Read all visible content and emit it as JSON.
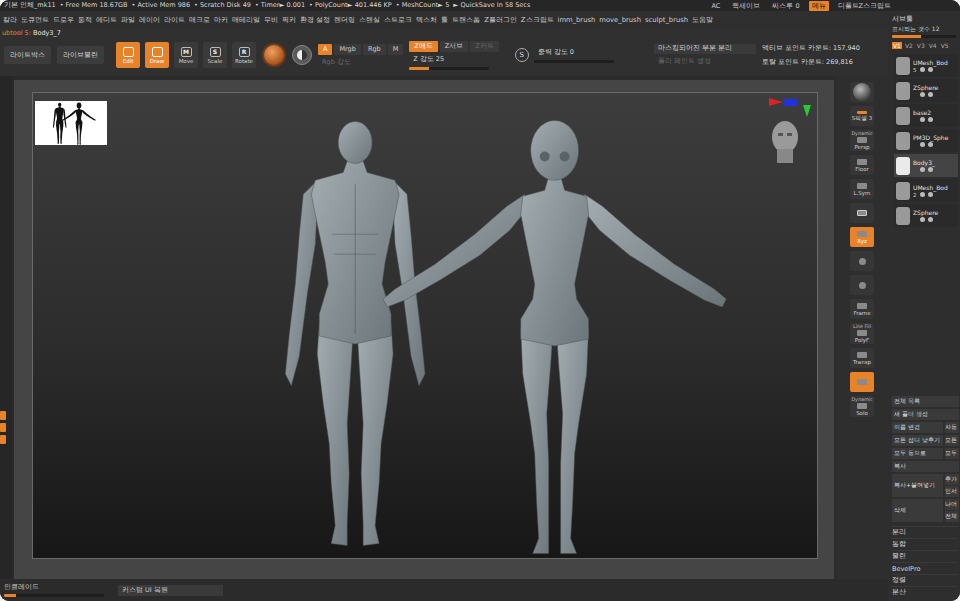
{
  "title_bar": {
    "items": [
      "기본 인체_mk11",
      "• Free Mem 18.67GB",
      "• Active Mem 986",
      "• Scratch Disk 49",
      "• Timer► 0.001",
      "• PolyCount► 401.446 KP",
      "• MeshCount► 5",
      "► QuickSave In 58 Secs"
    ],
    "right": [
      {
        "label": "AC",
        "selected": false
      },
      {
        "label": "퀵세이브",
        "selected": false
      },
      {
        "label": "씨스루 0",
        "selected": false
      },
      {
        "label": "메뉴",
        "selected": true
      },
      {
        "label": "디폴트Z스크립트",
        "selected": false
      }
    ]
  },
  "menu": [
    "칼라",
    "도큐먼트",
    "드로우",
    "동적",
    "에디트",
    "파일",
    "레이어",
    "라이트",
    "매크로",
    "마커",
    "매테리얼",
    "무비",
    "픽커",
    "환경 설정",
    "렌더링",
    "스텐실",
    "스트로크",
    "텍스처",
    "툴",
    "트랜스폼",
    "Z플러그인",
    "Z스크립트",
    "imm_brush",
    "move_brush",
    "sculpt_brush",
    "도움말"
  ],
  "tool_label": {
    "prefix": "ubtool 5:",
    "name": "Body3_7"
  },
  "toolbar": {
    "buttons": [
      "라이트박스",
      "라이브불린"
    ],
    "transform": [
      {
        "label": "Edit",
        "glyph": "",
        "selected": true
      },
      {
        "label": "Draw",
        "glyph": "",
        "selected": true
      },
      {
        "label": "Move",
        "glyph": "M",
        "selected": false
      },
      {
        "label": "Scale",
        "glyph": "S",
        "selected": false
      },
      {
        "label": "Rotate",
        "glyph": "R",
        "selected": false
      }
    ],
    "color_modes": [
      {
        "label": "A",
        "selected": true
      },
      {
        "label": "Mrgb",
        "selected": false
      },
      {
        "label": "Rgb",
        "selected": false
      },
      {
        "label": "M",
        "selected": false
      }
    ],
    "rgb_intensity": {
      "label": "Rgb 강도",
      "disabled": true
    },
    "z_modes": [
      {
        "label": "Z애드",
        "selected": true,
        "disabled": false
      },
      {
        "label": "Z서브",
        "selected": false,
        "disabled": false
      },
      {
        "label": "Z커트",
        "selected": false,
        "disabled": true
      }
    ],
    "z_intensity": {
      "label": "Z 강도 25",
      "level": 0.25
    },
    "gravity": {
      "glyph": "S",
      "label": "중력 강도 0",
      "level": 0
    },
    "actions": [
      {
        "label": "마스킹되어진 부분 분리",
        "disabled": false
      },
      {
        "label": "폴리 페인트 생성",
        "disabled": true
      }
    ],
    "counts": [
      "액티브 포인트 카운트: 157,940",
      "토탈 포인트 카운트: 269,816"
    ]
  },
  "shelf": [
    {
      "kind": "sphere",
      "label": "",
      "sub": "",
      "selected": false
    },
    {
      "kind": "slider",
      "label": "S픽셀 3",
      "sub": "",
      "selected": false
    },
    {
      "kind": "button",
      "label": "Persp",
      "sub": "Dynamic",
      "selected": false
    },
    {
      "kind": "button",
      "label": "Floor",
      "sub": "",
      "selected": false
    },
    {
      "kind": "button",
      "label": "L.Sym",
      "sub": "",
      "selected": false
    },
    {
      "kind": "lock",
      "label": "",
      "sub": "",
      "selected": false
    },
    {
      "kind": "button",
      "label": "Xyz",
      "sub": "",
      "selected": true
    },
    {
      "kind": "small",
      "label": "",
      "sub": "",
      "selected": false
    },
    {
      "kind": "small",
      "label": "",
      "sub": "",
      "selected": false
    },
    {
      "kind": "button",
      "label": "Frame",
      "sub": "",
      "selected": false
    },
    {
      "kind": "button",
      "label": "PolyF",
      "sub": "Line Fill",
      "selected": false
    },
    {
      "kind": "button",
      "label": "Transp",
      "sub": "",
      "selected": false
    },
    {
      "kind": "button",
      "label": "",
      "sub": "",
      "selected": true
    },
    {
      "kind": "button",
      "label": "Solo",
      "sub": "Dynamic",
      "selected": false
    }
  ],
  "subtool_panel": {
    "title": "서브툴",
    "count": "표시되는 갯수 12",
    "count_level": 0.45,
    "tabs": [
      {
        "label": "V1",
        "selected": true
      },
      {
        "label": "V2",
        "selected": false
      },
      {
        "label": "V3",
        "selected": false
      },
      {
        "label": "V4",
        "selected": false
      },
      {
        "label": "V5",
        "selected": false
      }
    ],
    "items": [
      {
        "name": "UMesh_Bod",
        "subdiv": "5",
        "selected": false
      },
      {
        "name": "ZSphere",
        "subdiv": "",
        "selected": false
      },
      {
        "name": "base2",
        "subdiv": "",
        "selected": false
      },
      {
        "name": "PM3D_Sphe",
        "subdiv": "",
        "selected": false
      },
      {
        "name": "Body3_",
        "subdiv": "",
        "selected": true
      },
      {
        "name": "UMesh_Bod",
        "subdiv": "2",
        "selected": false
      },
      {
        "name": "ZSphere",
        "subdiv": "",
        "selected": false
      }
    ],
    "button_rows": [
      {
        "left": "전체 목록",
        "right": []
      },
      {
        "left": "새 폴더 생성",
        "right": []
      },
      {
        "left": "이름 변경",
        "right": [
          "자동"
        ]
      },
      {
        "left": "모든 섭디 낮추기",
        "right": [
          "모든"
        ]
      },
      {
        "left": "모두 동으로",
        "right": [
          "모두"
        ]
      },
      {
        "left": "복사",
        "right": []
      },
      {
        "left": "복사+붙여넣기",
        "right": [
          "추가",
          "인서"
        ]
      },
      {
        "left": "삭제",
        "right": [
          "나머",
          "전체"
        ]
      }
    ],
    "sections": [
      "분리",
      "통합",
      "불린",
      "BevelPro",
      "정렬",
      "분산"
    ]
  },
  "bottom_bar": {
    "label": "인클레이드",
    "level": 0.12,
    "button": "커스텀 UI 복원"
  }
}
